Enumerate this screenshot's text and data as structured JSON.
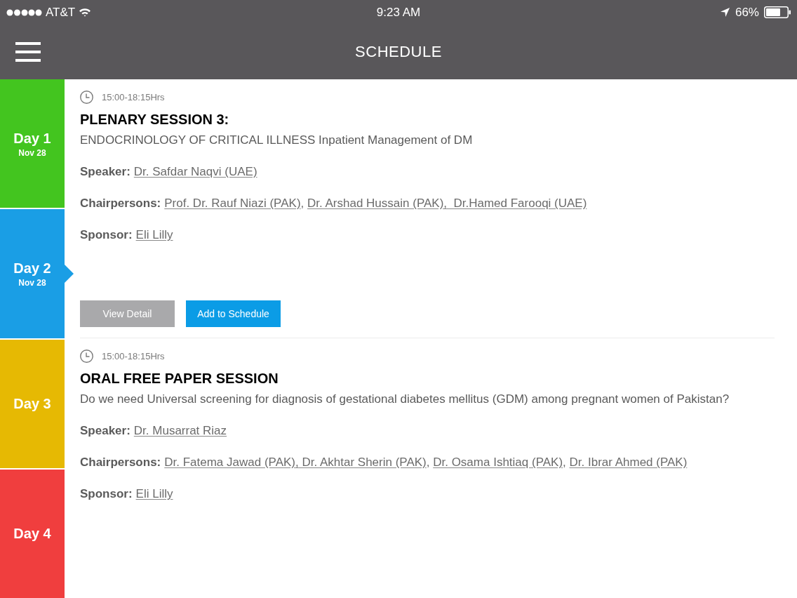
{
  "status_bar": {
    "carrier": "AT&T",
    "time": "9:23 AM",
    "battery": "66%"
  },
  "nav_bar": {
    "title": "SCHEDULE"
  },
  "days": [
    {
      "label": "Day 1",
      "date": "Nov 28",
      "color": "#43c51f",
      "selected": false
    },
    {
      "label": "Day 2",
      "date": "Nov 28",
      "color": "#1a9ee5",
      "selected": true
    },
    {
      "label": "Day 3",
      "color": "#e6b903",
      "selected": false
    },
    {
      "label": "Day 4",
      "color": "#f03e3e",
      "selected": false
    }
  ],
  "sessions": [
    {
      "time": "15:00-18:15Hrs",
      "title": "PLENARY SESSION 3:",
      "description": "ENDOCRINOLOGY OF CRITICAL ILLNESS Inpatient Management of DM",
      "details": [
        {
          "label": "Speaker:",
          "parts": [
            {
              "text": "Dr. Safdar Naqvi (UAE)",
              "link": true
            }
          ]
        },
        {
          "label": "Chairpersons:",
          "parts": [
            {
              "text": "Prof. Dr. Rauf Niazi (PAK)",
              "link": true
            },
            {
              "text": ", ",
              "link": false
            },
            {
              "text": "Dr. Arshad Hussain (PAK),  Dr.Hamed Farooqi (UAE)",
              "link": true
            }
          ]
        },
        {
          "label": "Sponsor:",
          "parts": [
            {
              "text": "Eli Lilly",
              "link": true
            }
          ]
        }
      ],
      "buttons": [
        {
          "label": "View Detail",
          "kind": "secondary"
        },
        {
          "label": "Add to Schedule",
          "kind": "primary"
        }
      ]
    },
    {
      "time": "15:00-18:15Hrs",
      "title": "ORAL FREE PAPER SESSION",
      "description": "Do we need Universal screening for diagnosis of gestational diabetes mellitus (GDM) among pregnant women of Pakistan?",
      "details": [
        {
          "label": "Speaker:",
          "parts": [
            {
              "text": "Dr. Musarrat Riaz",
              "link": true
            }
          ]
        },
        {
          "label": "Chairpersons:",
          "parts": [
            {
              "text": "Dr. Fatema Jawad (PAK), Dr. Akhtar Sherin (PAK)",
              "link": true
            },
            {
              "text": ", ",
              "link": false
            },
            {
              "text": "Dr. Osama Ishtiaq (PAK)",
              "link": true
            },
            {
              "text": ", ",
              "link": false
            },
            {
              "text": "Dr. Ibrar Ahmed (PAK)",
              "link": true
            }
          ]
        },
        {
          "label": "Sponsor:",
          "parts": [
            {
              "text": "Eli Lilly",
              "link": true
            }
          ]
        }
      ]
    }
  ]
}
